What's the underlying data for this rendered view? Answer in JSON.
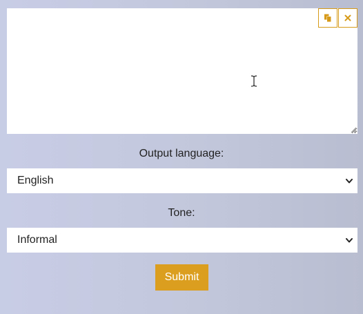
{
  "editor": {
    "value": "",
    "copy_icon": "copy-icon",
    "clear_icon": "close-icon"
  },
  "output_language": {
    "label": "Output language:",
    "selected": "English"
  },
  "tone": {
    "label": "Tone:",
    "selected": "Informal"
  },
  "submit": {
    "label": "Submit"
  },
  "colors": {
    "accent": "#dc9e1e",
    "field_background": "#ffffff"
  }
}
